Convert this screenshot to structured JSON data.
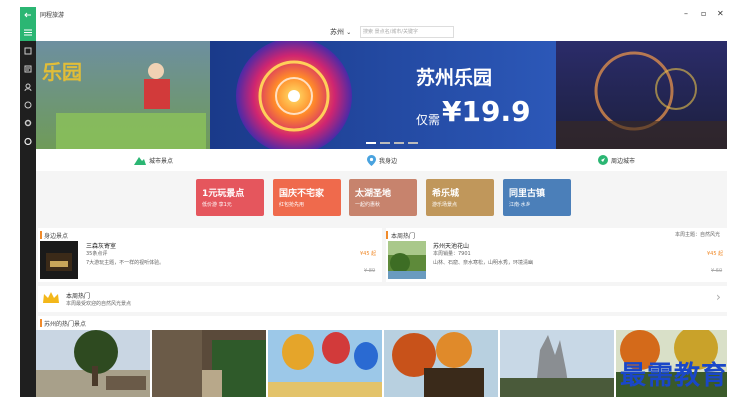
{
  "window": {
    "title": "同程旅游",
    "controls": {
      "minimize": "–",
      "maximize": "▫",
      "close": "✕"
    }
  },
  "search": {
    "city": "苏州",
    "placeholder": "搜索 景点名/城市/关键字"
  },
  "banner": {
    "title": "苏州乐园",
    "prefix": "仅需",
    "price": "¥19.9"
  },
  "tabs": [
    {
      "label": "城市景点"
    },
    {
      "label": "我身边"
    },
    {
      "label": "周边城市"
    }
  ],
  "categories": [
    {
      "title": "1元玩景点",
      "subtitle": "低价游 享1元",
      "color": "#e5565d"
    },
    {
      "title": "国庆不宅家",
      "subtitle": "红包抢先用",
      "color": "#ef6a4c"
    },
    {
      "title": "太湖圣地",
      "subtitle": "一起约惠秋",
      "color": "#c7836d"
    },
    {
      "title": "希乐城",
      "subtitle": "游乐场景点",
      "color": "#c0975b"
    },
    {
      "title": "同里古镇",
      "subtitle": "江南·水乡",
      "color": "#4b7fb9"
    }
  ],
  "nearby": {
    "heading": "身边景点",
    "item": {
      "name": "三森灰寄室",
      "reviews": "35条点评",
      "desc": "7大游玩主题，不一样的视听体验。",
      "price": "¥45 起",
      "original": "¥ 89"
    }
  },
  "weekly": {
    "heading": "本周热门",
    "theme": "本周主题：自然风光",
    "item": {
      "name": "苏州天池花山",
      "sales": "本周销量：7901",
      "tags": "山林、石窟、奈水寒松，山明水秀，环境清幽",
      "price": "¥45 起",
      "original": "¥ 60"
    },
    "promo_title": "本周热门",
    "promo_sub": "本周最受欢迎的自然风光景点"
  },
  "popular": {
    "heading": "苏州的热门景点"
  },
  "watermark": "最需教育",
  "colors": {
    "accent": "#2bb673",
    "price": "#f08a2a",
    "sidebar": "#1f1f1f"
  }
}
